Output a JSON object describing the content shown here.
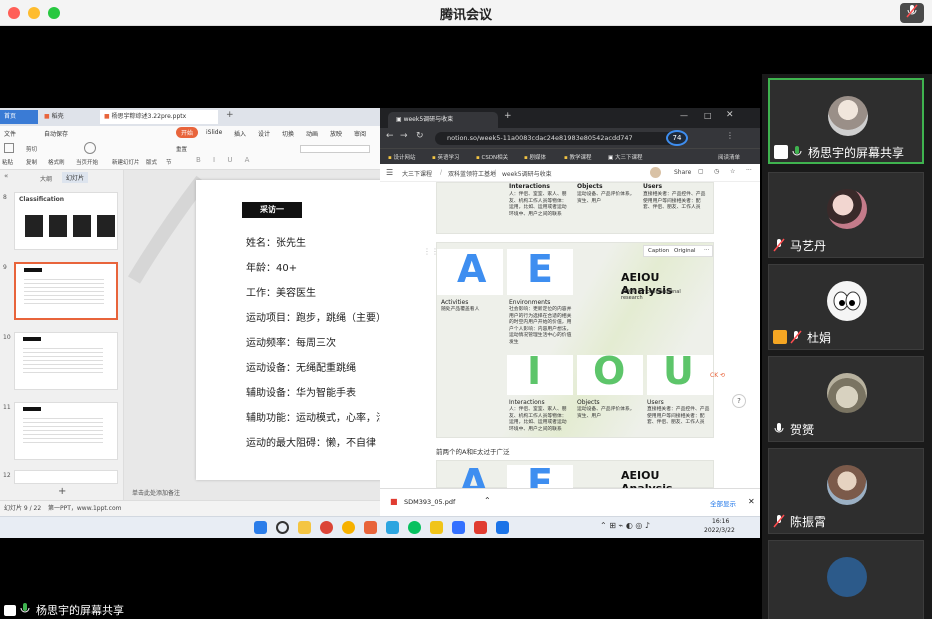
{
  "window": {
    "title": "腾讯会议"
  },
  "wps": {
    "tabs": [
      "首页",
      "稻壳",
      "杨思宇粽综述3.22pre.pptx"
    ],
    "menu": [
      "文件",
      "自动保存",
      "开始",
      "插入",
      "设计",
      "切换",
      "动画",
      "放映",
      "审阅",
      "iSlide"
    ],
    "tools": [
      "粘贴",
      "剪切",
      "复制",
      "格式刷",
      "当页开始",
      "新建幻灯片",
      "版式",
      "节",
      "重置"
    ],
    "panel_tabs": [
      "大纲",
      "幻灯片"
    ],
    "thumb_8_title": "Classification",
    "slide_numbers": [
      "8",
      "9",
      "10",
      "11",
      "12"
    ],
    "slide": {
      "badge": "采访一",
      "lines": [
        "姓名：张先生",
        "年龄：40+",
        "工作：美容医生",
        "运动项目：跑步，跳绳（主要）",
        "运动频率：每周三次",
        "运动设备：无绳配重跳绳",
        "辅助设备：华为智能手表",
        "辅助功能：运动模式，心率，活",
        "运动的最大阻碍：懒，不自律"
      ]
    },
    "status": {
      "slide_info": "幻灯片 9 / 22",
      "theme": "第一PPT，www.1ppt.com",
      "notes": "单击此处添加备注"
    }
  },
  "chrome": {
    "tab_title": "week5调研与收束",
    "url": "notion.so/week5-11a0083cdac24e81983e80542acdd747",
    "bookmarks": [
      "设计网站",
      "英语学习",
      "CSDN相关",
      "剧媒体",
      "教学课程",
      "大三下课程",
      "阅读清单"
    ],
    "breadcrumb": [
      "大三下课程",
      "双科蓝领符工基地",
      "week5调研与收束"
    ],
    "share": "Share",
    "zoom_badge": "74",
    "image_toolbar": [
      "Caption",
      "Original"
    ],
    "card": {
      "letters_top": [
        "A",
        "E"
      ],
      "letters_bottom": [
        "I",
        "O",
        "U"
      ],
      "title": "AEIOU Analysis",
      "subtitle": "AEIOU for observational research",
      "labels": [
        "Activities",
        "Environments",
        "Interactions",
        "Objects",
        "Users"
      ],
      "activities_text": "随处产品覆盖看人",
      "environments_text": "社会影响：更新定位的内容并用户的行为选择在合适的相关的时空内用户开始的价值，用户个人影响：内容用户想法，运动情况管理生活中心的价值发生",
      "interactions_text": "人：伴侣、室室、家人、朋友、机构工作人员等物体：运用，比如、运用或者运动环境中、用户之间的联系",
      "objects_text": "运动设备、产品评价体系，资生、用户",
      "users_text": "直接相关者：产品控件、产品使用用户等间接相关者：配套、伴侣、朋友、工作人员"
    },
    "caption": "前两个的A和E太过于广泛",
    "download": {
      "file": "SDM393_05.pdf",
      "show_all": "全部显示"
    }
  },
  "taskbar": {
    "time": "16:16",
    "date": "2022/3/22"
  },
  "meeting": {
    "bottom_label": "杨思宇的屏幕共享",
    "participants": [
      {
        "name": "杨思宇的屏幕共享",
        "active": true
      },
      {
        "name": "马艺丹",
        "active": false
      },
      {
        "name": "杜娟",
        "active": false
      },
      {
        "name": "贺赟",
        "active": false
      },
      {
        "name": "陈振霄",
        "active": false
      }
    ]
  },
  "colors": {
    "accent_green": "#3fb34f",
    "wps_orange": "#e8643b",
    "notion_green": "#5dc56a",
    "notion_blue": "#3e8ef0"
  }
}
